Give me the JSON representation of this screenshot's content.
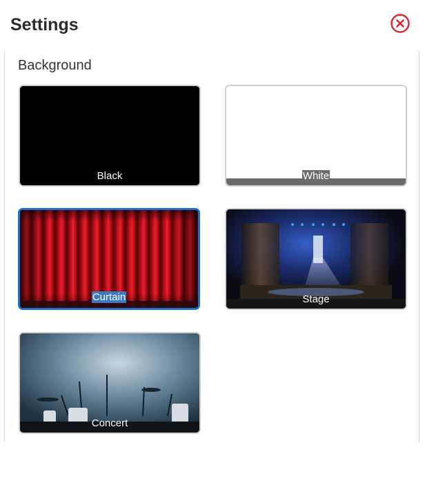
{
  "header": {
    "title": "Settings",
    "close_icon": "close-circle-icon",
    "accent": "#e0242b"
  },
  "background": {
    "label": "Background",
    "selected": "Curtain",
    "selection_color": "#1a73c8",
    "options": [
      {
        "label": "Black"
      },
      {
        "label": "White"
      },
      {
        "label": "Curtain"
      },
      {
        "label": "Stage"
      },
      {
        "label": "Concert"
      }
    ]
  }
}
